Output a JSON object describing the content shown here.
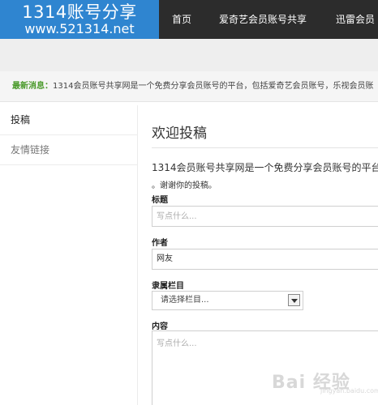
{
  "header": {
    "logo_line1": "1314账号分享",
    "logo_line2": "www.521314.net",
    "nav": [
      "首页",
      "爱奇艺会员账号共享",
      "迅雷会员"
    ]
  },
  "notice": {
    "label": "最新消息：",
    "text": "1314会员账号共享网是一个免费分享会员账号的平台，包括爱奇艺会员账号，乐视会员账"
  },
  "sidebar": {
    "items": [
      "投稿",
      "友情链接"
    ]
  },
  "main": {
    "title": "欢迎投稿",
    "intro_line1": "1314会员账号共享网是一个免费分享会员账号的平台",
    "intro_line2": "。谢谢你的投稿。",
    "form": {
      "title_label": "标题",
      "title_placeholder": "写点什么...",
      "author_label": "作者",
      "author_value": "网友",
      "category_label": "隶属栏目",
      "category_selected": "请选择栏目...",
      "content_label": "内容",
      "content_placeholder": "写点什么..."
    }
  },
  "watermark": {
    "text": "Bai 经验",
    "sub": "jingyan.baidu.com"
  }
}
